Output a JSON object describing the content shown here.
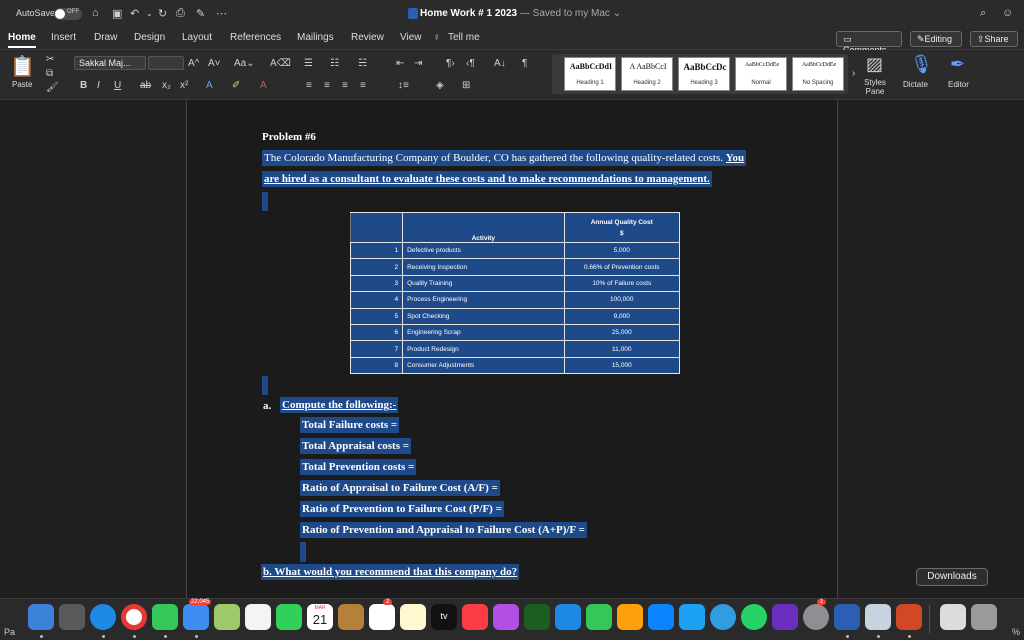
{
  "titlebar": {
    "autosave_label": "AutoSave",
    "autosave_state": "OFF",
    "document_name": "Home Work # 1 2023",
    "saved_status": "— Saved to my Mac"
  },
  "ribbon_tabs": [
    "Home",
    "Insert",
    "Draw",
    "Design",
    "Layout",
    "References",
    "Mailings",
    "Review",
    "View"
  ],
  "tell_me": "Tell me",
  "top_buttons": {
    "comments": "Comments",
    "editing": "Editing",
    "share": "Share"
  },
  "ribbon": {
    "paste_label": "Paste",
    "font_name": "Sakkal Maj...",
    "styles": [
      {
        "sample": "AaBbCcDdI",
        "name": "Heading 1"
      },
      {
        "sample": "A AaBbCcI",
        "name": "Heading 2"
      },
      {
        "sample": "AaBbCcDc",
        "name": "Heading 3"
      },
      {
        "sample": "AaBbCcDdEe",
        "name": "Normal"
      },
      {
        "sample": "AaBbCcDdEe",
        "name": "No Spacing"
      }
    ],
    "styles_pane_label": "Styles Pane",
    "dictate_label": "Dictate",
    "editor_label": "Editor"
  },
  "document": {
    "problem_title": "Problem #6",
    "intro_part1": "The Colorado Manufacturing Company of Boulder, CO has gathered the following quality-related costs. ",
    "intro_part2": "You",
    "intro_line2": "are hired as a consultant to evaluate these costs and to make recommendations to management.",
    "table": {
      "col_activity": "Activity",
      "col_cost": "Annual Quality Cost",
      "col_cost_unit": "$",
      "rows": [
        {
          "no": "1",
          "activity": "Defective products",
          "cost": "5,000"
        },
        {
          "no": "2",
          "activity": "Receiving Inspection",
          "cost": "0.66% of Prevention costs"
        },
        {
          "no": "3",
          "activity": "Quality Training",
          "cost": "10% of Failure costs"
        },
        {
          "no": "4",
          "activity": "Process Engineering",
          "cost": "100,000"
        },
        {
          "no": "5",
          "activity": "Spot Checking",
          "cost": "9,000"
        },
        {
          "no": "6",
          "activity": "Engineering Scrap",
          "cost": "25,000"
        },
        {
          "no": "7",
          "activity": "Product Redesign",
          "cost": "11,000"
        },
        {
          "no": "8",
          "activity": "Consumer Adjustments",
          "cost": "15,000"
        }
      ]
    },
    "part_a_label": "a.",
    "part_a_title": "Compute the following:-",
    "compute_items": [
      "Total Failure costs =",
      "Total Appraisal costs =",
      "Total Prevention costs =",
      "Ratio of Appraisal to Failure Cost (A/F) =",
      "Ratio of Prevention to Failure Cost (P/F) =",
      "Ratio of Prevention and Appraisal to Failure Cost (A+P)/F ="
    ],
    "part_b": "b. What would you recommend that this company do?"
  },
  "dock": {
    "downloads_tooltip": "Downloads",
    "calendar_month": "MAR",
    "calendar_day": "21",
    "mail_badge": "22,045",
    "reminders_badge": "2",
    "settings_badge": "1",
    "tv_label": "tv"
  },
  "status": {
    "page_label": "Pa",
    "zoom_label": "%"
  },
  "colors": {
    "selection": "#1f4a8a",
    "word_blue": "#2b5fb3"
  }
}
